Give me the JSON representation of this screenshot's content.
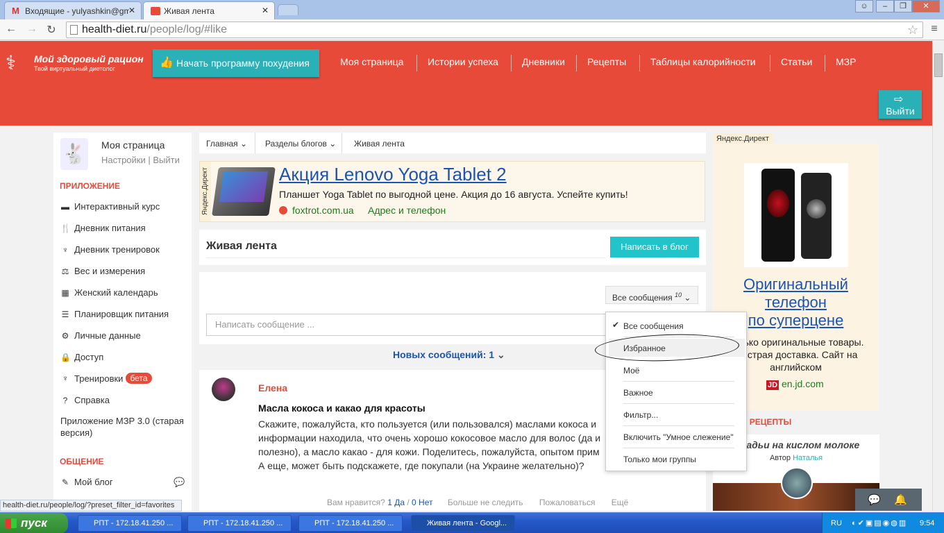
{
  "browser": {
    "tabs": [
      {
        "title": "Входящие - yulyashkin@gm",
        "icon": "gmail-icon"
      },
      {
        "title": "Живая лента",
        "icon": "site-favicon"
      }
    ],
    "url_host": "health-diet.ru",
    "url_path": "/people/log/#like"
  },
  "header": {
    "logo_title": "Мой здоровый рацион",
    "logo_subtitle": "Твой виртуальный диетолог",
    "start_button": "Начать программу похудения",
    "nav": [
      "Моя страница",
      "Истории успеха",
      "Дневники",
      "Рецепты",
      "Таблицы калорийности",
      "Статьи",
      "МЗР"
    ],
    "logout": "Выйти"
  },
  "sidebar": {
    "my_page": "Моя страница",
    "settings": "Настройки",
    "pipe": "|",
    "exit": "Выйти",
    "section_app": "ПРИЛОЖЕНИЕ",
    "items": [
      {
        "label": "Интерактивный курс",
        "icon": "course-icon"
      },
      {
        "label": "Дневник питания",
        "icon": "fork-knife-icon"
      },
      {
        "label": "Дневник тренировок",
        "icon": "training-icon"
      },
      {
        "label": "Вес и измерения",
        "icon": "weight-icon"
      },
      {
        "label": "Женский календарь",
        "icon": "calendar-icon"
      },
      {
        "label": "Планировщик питания",
        "icon": "planner-icon"
      },
      {
        "label": "Личные данные",
        "icon": "gears-icon"
      },
      {
        "label": "Доступ",
        "icon": "lock-icon"
      },
      {
        "label": "Тренировки",
        "icon": "training-icon"
      },
      {
        "label": "Справка",
        "icon": "help-icon"
      },
      {
        "label": "Приложение МЗР 3.0 (старая версия)",
        "icon": ""
      }
    ],
    "beta": "бета",
    "section_social": "ОБЩЕНИЕ",
    "my_blog": "Мой блог"
  },
  "breadcrumb": {
    "home": "Главная",
    "sections": "Разделы блогов",
    "current": "Живая лента"
  },
  "ad_top": {
    "vertical_label": "Яндекс.Директ",
    "title": "Акция Lenovo Yoga Tablet 2",
    "text": "Планшет Yoga Tablet по выгодной цене. Акция до 16 августа. Успейте купить!",
    "domain": "foxtrot.com.ua",
    "extra": "Адрес и телефон"
  },
  "feed": {
    "title": "Живая лента",
    "write_button": "Написать в блог",
    "filter_label": "Все сообщения",
    "filter_count": "10",
    "message_placeholder": "Написать сообщение ...",
    "new_messages": "Новых сообщений: 1"
  },
  "dropdown": {
    "items": [
      "Все сообщения",
      "Избранное",
      "Моё",
      "Важное",
      "Фильтр...",
      "Включить \"Умное слежение\"",
      "Только мои группы"
    ],
    "checked_index": 0
  },
  "post": {
    "author": "Елена",
    "title": "Масла кокоса и какао для красоты",
    "body_lines": [
      "Скажите, пожалуйста, кто пользуется (или пользовался) маслами кокоса и",
      "информации находила, что очень хорошо кокосовое масло для волос (да и",
      "полезно), а масло какао - для кожи. Поделитесь, пожалуйста, опытом прим",
      "А еще, может быть подскажете, где покупали (на Украине желательно)?"
    ],
    "like_q": "Вам нравится?",
    "yes": "1 Да",
    "slash": "/",
    "no": "0 Нет",
    "unfollow": "Больше не следить",
    "report": "Пожаловаться",
    "more": "Ещё"
  },
  "ad_right": {
    "label": "Яндекс.Директ",
    "title_lines": [
      "Оригинальный",
      "телефон",
      "по суперцене"
    ],
    "text_lines": [
      "Только оригинальные товары.",
      "Быстрая доставка. Сайт на",
      "английском"
    ],
    "badge": "JD",
    "domain": "en.jd.com"
  },
  "recipes": {
    "heading": "НОВЫЕ РЕЦЕПТЫ",
    "card_title": "Оладьи на кислом молоке",
    "author_label": "Автор",
    "author": "Наталья"
  },
  "status_url": "health-diet.ru/people/log/?preset_filter_id=favorites",
  "taskbar": {
    "start": "пуск",
    "tasks": [
      "РПТ - 172.18.41.250 ...",
      "РПТ - 172.18.41.250 ...",
      "РПТ - 172.18.41.250 ...",
      "Живая лента - Googl..."
    ],
    "lang": "RU",
    "time": "9:54"
  },
  "colors": {
    "brand_red": "#e84a3a",
    "teal": "#2ab0b7",
    "link_blue": "#1a55b5"
  }
}
